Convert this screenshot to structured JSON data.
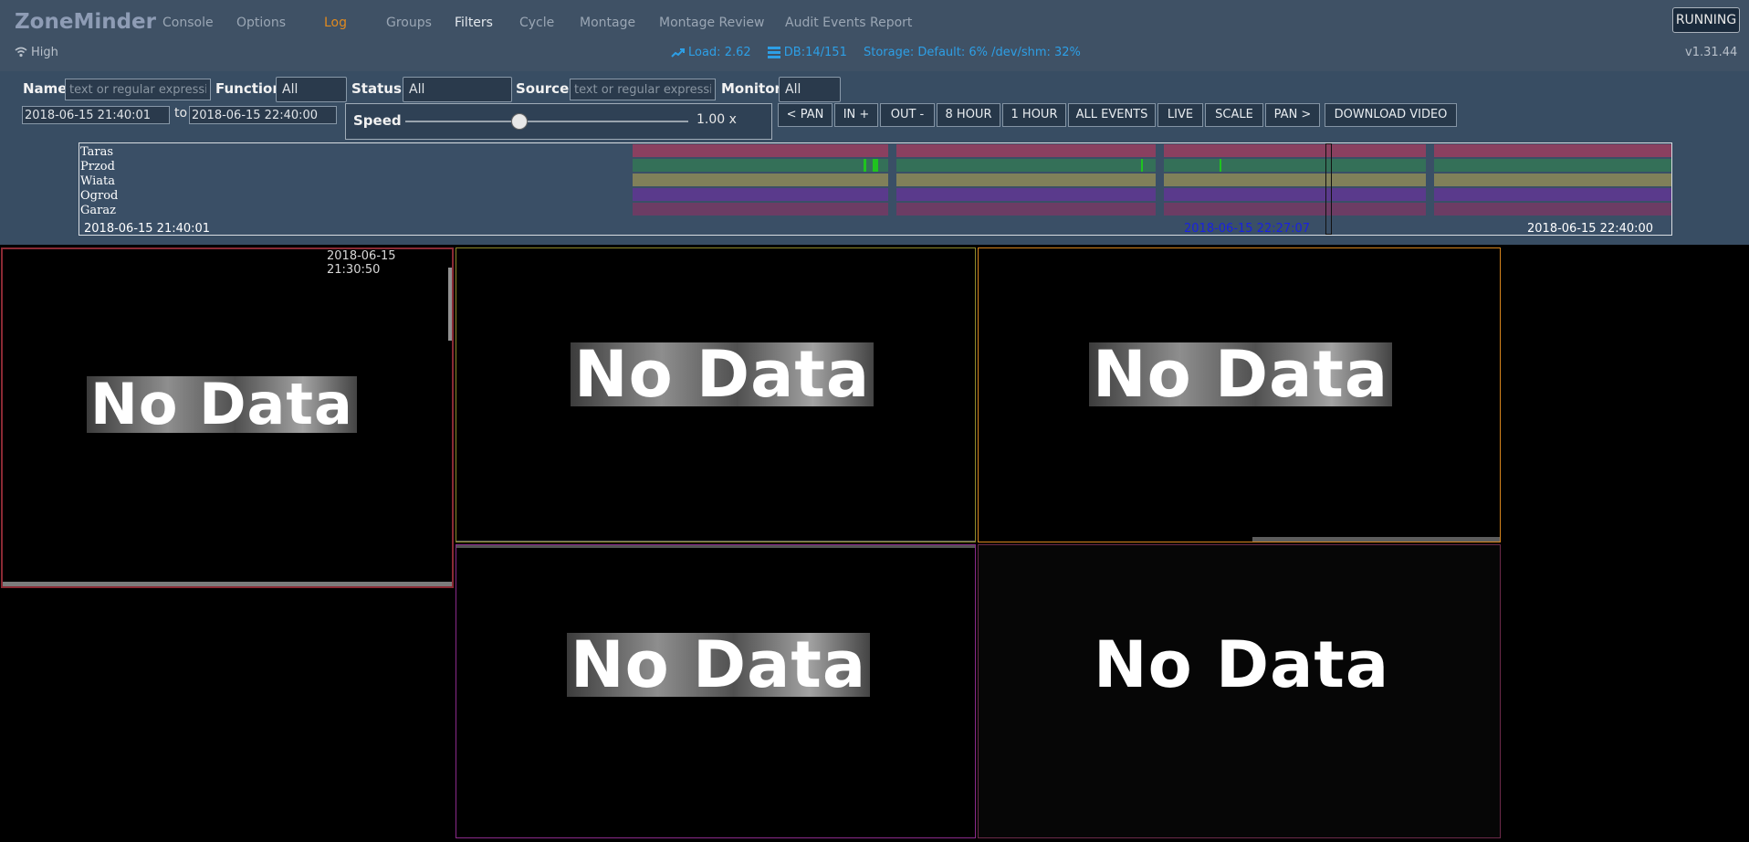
{
  "app": {
    "brand": "ZoneMinder",
    "nav": [
      "Console",
      "Options",
      "Log",
      "Groups",
      "Filters",
      "Cycle",
      "Montage",
      "Montage Review",
      "Audit Events Report"
    ],
    "active_nav": "Log",
    "status_button": "RUNNING",
    "bandwidth": "High",
    "load": "Load: 2.62",
    "db": "DB:14/151",
    "storage": "Storage: Default: 6% /dev/shm: 32%",
    "version": "v1.31.44"
  },
  "filters": {
    "name_label": "Name",
    "name_placeholder": "text or regular expression",
    "function_label": "Function",
    "function_value": "All",
    "status_label": "Status:",
    "status_value": "All",
    "source_label": "Source:",
    "source_placeholder": "text or regular expression",
    "monitor_label": "Monitor:",
    "monitor_value": "All",
    "start_time": "2018-06-15 21:40:01",
    "to_label": "to",
    "end_time": "2018-06-15 22:40:00",
    "speed_label": "Speed",
    "speed_value": "1.00 x",
    "speed_fraction": 0.4,
    "buttons": {
      "pan_left": "< PAN",
      "zoom_in": "IN +",
      "zoom_out": "OUT -",
      "eight_hour": "8 HOUR",
      "one_hour": "1 HOUR",
      "all_events": "ALL EVENTS",
      "live": "LIVE",
      "scale": "SCALE",
      "pan_right": "PAN >",
      "download": "DOWNLOAD VIDEO"
    }
  },
  "timeline": {
    "monitors": [
      {
        "name": "Taras",
        "color": "#8a4060"
      },
      {
        "name": "Przod",
        "color": "#347058"
      },
      {
        "name": "Wiata",
        "color": "#80805a"
      },
      {
        "name": "Ogrod",
        "color": "#5a3a8c"
      },
      {
        "name": "Garaz",
        "color": "#6c3c64"
      }
    ],
    "start_label": "2018-06-15 21:40:01",
    "cursor_label": "2018-06-15 22:27:07",
    "end_label": "2018-06-15 22:40:00"
  },
  "monitors": [
    {
      "name": "Taras",
      "no_data": "No Data",
      "timestamp": "2018-06-15 21:30:50",
      "border": "#8a2a34"
    },
    {
      "name": "Przod",
      "no_data": "No Data",
      "border": "#8f8a2a"
    },
    {
      "name": "Wiata",
      "no_data": "No Data",
      "border": "#d7851d"
    },
    {
      "name": "Ogrod",
      "no_data": "No Data",
      "border": "#8a2a8a"
    },
    {
      "name": "Garaz",
      "no_data": "No Data",
      "border": "#6c2a4a"
    }
  ]
}
